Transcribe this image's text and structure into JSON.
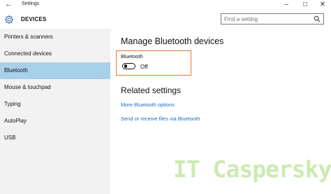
{
  "window": {
    "back_icon": "back-arrow-icon",
    "title": "Settings",
    "controls": [
      "minimize-icon",
      "maximize-icon",
      "close-icon"
    ]
  },
  "header": {
    "icon": "gear-icon",
    "title": "DEVICES",
    "search_placeholder": "Find a setting",
    "search_icon": "search-icon"
  },
  "sidebar": {
    "items": [
      {
        "label": "Printers & scanners",
        "active": false
      },
      {
        "label": "Connected devices",
        "active": false
      },
      {
        "label": "Bluetooth",
        "active": true
      },
      {
        "label": "Mouse & touchpad",
        "active": false
      },
      {
        "label": "Typing",
        "active": false
      },
      {
        "label": "AutoPlay",
        "active": false
      },
      {
        "label": "USB",
        "active": false
      }
    ]
  },
  "main": {
    "heading": "Manage Bluetooth devices",
    "bluetooth_label": "Bluetooth",
    "toggle_state": "Off",
    "toggle_on": false,
    "related_heading": "Related settings",
    "links": [
      "More Bluetooth options",
      "Send or receive files via Bluetooth"
    ]
  },
  "watermark": "IT Caspersky",
  "colors": {
    "sidebar_bg": "#f2f2f2",
    "active_item": "#a8d0eb",
    "link": "#1a6fc2",
    "highlight_border": "#e8772e",
    "watermark": "#8cd250"
  }
}
